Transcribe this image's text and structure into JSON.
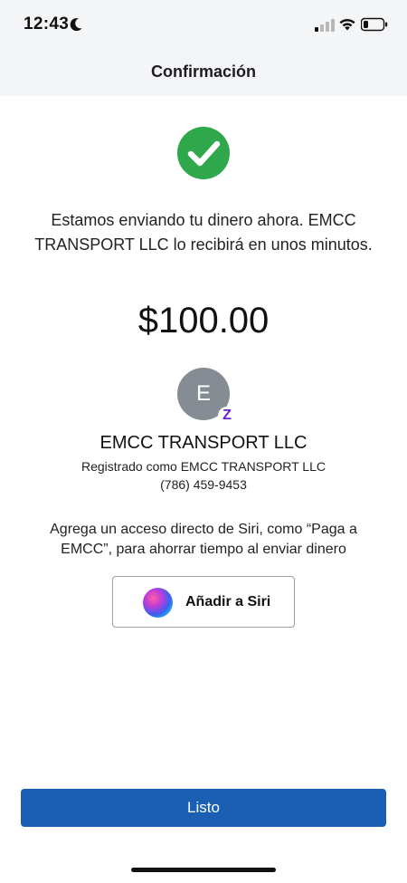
{
  "status_bar": {
    "time": "12:43",
    "icons": [
      "moon-icon",
      "signal-icon",
      "wifi-icon",
      "battery-icon"
    ]
  },
  "header": {
    "title": "Confirmación"
  },
  "confirmation": {
    "icon": "check-circle-icon",
    "accent_color": "#2ea84a",
    "message": "Estamos enviando tu dinero ahora. EMCC TRANSPORT LLC lo recibirá en unos minutos.",
    "amount": "$100.00"
  },
  "recipient": {
    "avatar_initial": "E",
    "badge_glyph": "Z",
    "badge_color": "#6d1ed4",
    "name": "EMCC TRANSPORT LLC",
    "registered_as": "Registrado como EMCC TRANSPORT LLC",
    "phone": "(786) 459-9453"
  },
  "siri": {
    "prompt": "Agrega un acceso directo de Siri, como “Paga a EMCC”, para ahorrar tiempo al enviar dinero",
    "button_label": "Añadir a Siri"
  },
  "actions": {
    "done_label": "Listo",
    "done_color": "#1a5fb4"
  }
}
